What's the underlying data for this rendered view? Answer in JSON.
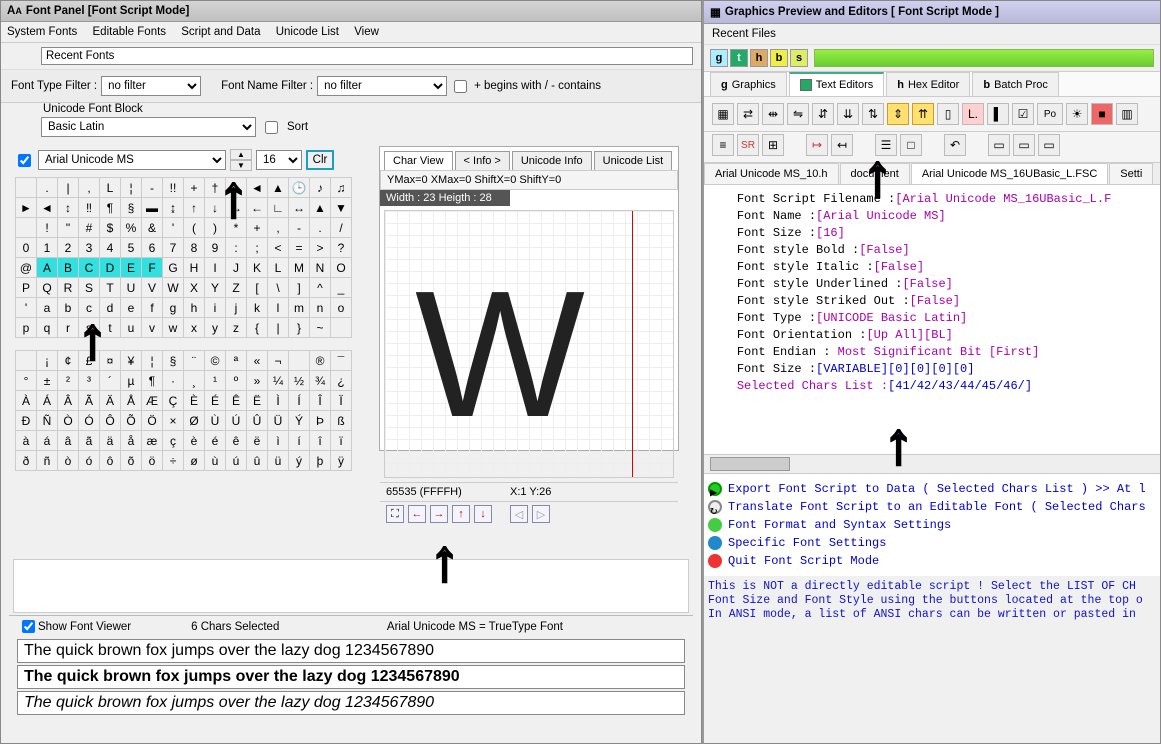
{
  "left": {
    "title": "Font Panel [Font Script Mode]",
    "menu": [
      "System Fonts",
      "Editable Fonts",
      "Script and Data",
      "Unicode List",
      "View"
    ],
    "recent_label": "Recent Fonts",
    "type_filter_label": "Font Type Filter :",
    "type_filter_value": "no filter",
    "name_filter_label": "Font Name Filter :",
    "name_filter_value": "no filter",
    "begins_label": "+ begins with / - contains",
    "block_label": "Unicode Font Block",
    "block_value": "Basic Latin",
    "sort_label": "Sort",
    "font_name": "Arial Unicode MS",
    "font_size": "16",
    "clr_label": "Clr",
    "char_tabs": [
      "Char View",
      "< Info >",
      "Unicode Info",
      "Unicode List"
    ],
    "metrics": "YMax=0  XMax=0  ShiftX=0  ShiftY=0",
    "dim_label": "Width : 23  Heigth : 28",
    "code_label": "65535  (FFFFH)",
    "pos_label": "X:1 Y:26",
    "viewer_cb": "Show Font Viewer",
    "chars_selected": "6 Chars Selected",
    "font_type_status": "Arial Unicode MS = TrueType Font",
    "pangram": "The quick brown fox jumps over the lazy dog 1234567890",
    "grid_rows": [
      [
        " ",
        ".",
        "|",
        ",",
        "L",
        "¦",
        "-",
        "!!",
        "+",
        "†",
        " ",
        "◄",
        "▲",
        "🕒",
        "♪",
        "♫"
      ],
      [
        "►",
        "◄",
        "↕",
        "‼",
        "¶",
        "§",
        "▬",
        "↨",
        "↑",
        "↓",
        "→",
        "←",
        "∟",
        "↔",
        "▲",
        "▼"
      ],
      [
        " ",
        "!",
        "\"",
        "#",
        "$",
        "%",
        "&",
        "'",
        "(",
        ")",
        "*",
        "+",
        ",",
        "-",
        ".",
        "/"
      ],
      [
        "0",
        "1",
        "2",
        "3",
        "4",
        "5",
        "6",
        "7",
        "8",
        "9",
        ":",
        ";",
        "<",
        "=",
        ">",
        "?"
      ],
      [
        "@",
        "A",
        "B",
        "C",
        "D",
        "E",
        "F",
        "G",
        "H",
        "I",
        "J",
        "K",
        "L",
        "M",
        "N",
        "O"
      ],
      [
        "P",
        "Q",
        "R",
        "S",
        "T",
        "U",
        "V",
        "W",
        "X",
        "Y",
        "Z",
        "[",
        "\\",
        "]",
        "^",
        "_"
      ],
      [
        "'",
        "a",
        "b",
        "c",
        "d",
        "e",
        "f",
        "g",
        "h",
        "i",
        "j",
        "k",
        "l",
        "m",
        "n",
        "o"
      ],
      [
        "p",
        "q",
        "r",
        "s",
        "t",
        "u",
        "v",
        "w",
        "x",
        "y",
        "z",
        "{",
        "|",
        "}",
        "~",
        " "
      ]
    ],
    "grid_rows2": [
      [
        " ",
        "¡",
        "¢",
        "£",
        "¤",
        "¥",
        "¦",
        "§",
        "¨",
        "©",
        "ª",
        "«",
        "¬",
        " ",
        "®",
        "¯"
      ],
      [
        "°",
        "±",
        "²",
        "³",
        "´",
        "µ",
        "¶",
        "·",
        "¸",
        "¹",
        "º",
        "»",
        "¼",
        "½",
        "¾",
        "¿"
      ],
      [
        "À",
        "Á",
        "Â",
        "Ã",
        "Ä",
        "Å",
        "Æ",
        "Ç",
        "È",
        "É",
        "Ê",
        "Ë",
        "Ì",
        "Í",
        "Î",
        "Ï"
      ],
      [
        "Ð",
        "Ñ",
        "Ò",
        "Ó",
        "Ô",
        "Õ",
        "Ö",
        "×",
        "Ø",
        "Ù",
        "Ú",
        "Û",
        "Ü",
        "Ý",
        "Þ",
        "ß"
      ],
      [
        "à",
        "á",
        "â",
        "ã",
        "ä",
        "å",
        "æ",
        "ç",
        "è",
        "é",
        "ê",
        "ë",
        "ì",
        "í",
        "î",
        "ï"
      ],
      [
        "ð",
        "ñ",
        "ò",
        "ó",
        "ô",
        "õ",
        "ö",
        "÷",
        "ø",
        "ù",
        "ú",
        "û",
        "ü",
        "ý",
        "þ",
        "ÿ"
      ]
    ],
    "selected_cells": [
      "A",
      "B",
      "C",
      "D",
      "E",
      "F"
    ]
  },
  "right": {
    "title": "Graphics Preview and Editors [ Font Script Mode ]",
    "recent_label": "Recent Files",
    "mode_tabs": [
      {
        "icon": "g",
        "label": "Graphics"
      },
      {
        "icon": "t",
        "label": "Text Editors"
      },
      {
        "icon": "h",
        "label": "Hex Editor"
      },
      {
        "icon": "b",
        "label": "Batch Proc"
      }
    ],
    "doc_tabs": [
      "Arial Unicode MS_10.h",
      "document",
      "Arial Unicode MS_16UBasic_L.FSC",
      "Setti"
    ],
    "code_lines": [
      {
        "k": "Font Script Filename :",
        "v": "[Arial Unicode MS_16UBasic_L.F"
      },
      {
        "k": "Font Name :",
        "v": "[Arial Unicode MS]"
      },
      {
        "k": "Font Size :",
        "v": "[16]"
      },
      {
        "k": "Font style Bold :",
        "v": "[False]"
      },
      {
        "k": "Font style Italic :",
        "v": "[False]"
      },
      {
        "k": "Font style Underlined :",
        "v": "[False]"
      },
      {
        "k": "Font style Striked Out :",
        "v": "[False]"
      },
      {
        "k": "Font Type :",
        "v": "[UNICODE Basic Latin]"
      },
      {
        "k": "Font Orientation :",
        "v": "[Up All][BL]"
      },
      {
        "k": "Font Endian :",
        "v": " Most Significant Bit [First]"
      },
      {
        "k": "Font Size :",
        "v": "[VARIABLE][0][0][0][0]"
      },
      {
        "k": "Selected Chars List :",
        "v": "[41/42/43/44/45/46/]"
      }
    ],
    "links": [
      "Export Font Script to Data  ( Selected Chars List ) >> At l",
      "Translate Font Script to an Editable Font ( Selected Chars ",
      "Font Format and Syntax Settings",
      "Specific Font Settings",
      "Quit Font Script Mode"
    ],
    "warn1": " This is NOT a directly editable script ! Select the LIST OF CH",
    "warn2": "Font Size and Font Style using the buttons located at the top o",
    "warn3": " In ANSI mode, a list of ANSI chars can be written or pasted in"
  }
}
